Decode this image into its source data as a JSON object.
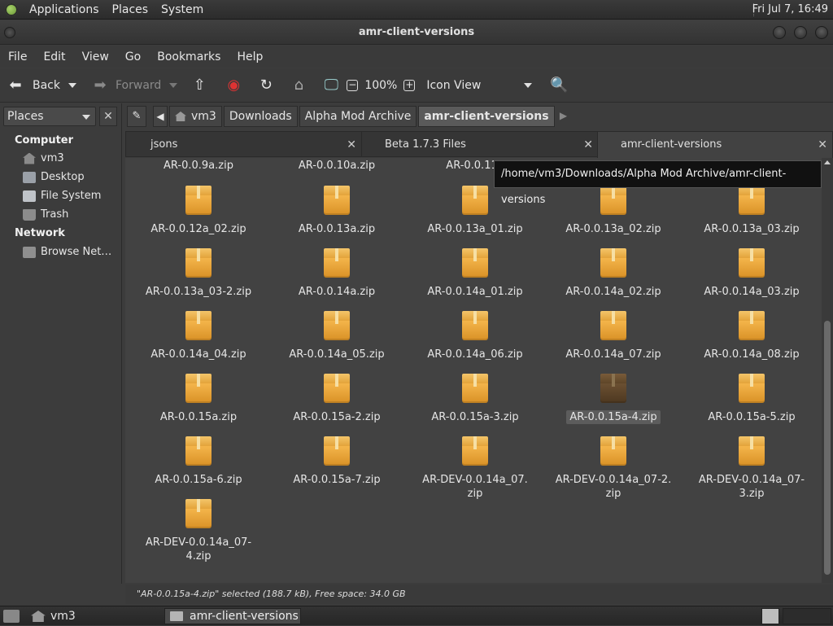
{
  "top_panel": {
    "menus": [
      "Applications",
      "Places",
      "System"
    ],
    "clock": "Fri Jul  7, 16:49"
  },
  "window": {
    "title": "amr-client-versions"
  },
  "menubar": [
    "File",
    "Edit",
    "View",
    "Go",
    "Bookmarks",
    "Help"
  ],
  "toolbar": {
    "back_label": "Back",
    "forward_label": "Forward",
    "zoom": "100%",
    "view_mode": "Icon View"
  },
  "sidebar": {
    "selector": "Places",
    "sections": [
      {
        "title": "Computer",
        "items": [
          "vm3",
          "Desktop",
          "File System",
          "Trash"
        ]
      },
      {
        "title": "Network",
        "items": [
          "Browse Net…"
        ]
      }
    ]
  },
  "location": {
    "crumbs": [
      "vm3",
      "Downloads",
      "Alpha Mod Archive",
      "amr-client-versions"
    ]
  },
  "tabs": [
    {
      "label": "jsons",
      "active": false
    },
    {
      "label": "Beta 1.7.3 Files",
      "active": false
    },
    {
      "label": "amr-client-versions",
      "active": true
    }
  ],
  "tooltip": "/home/vm3/Downloads/Alpha Mod Archive/amr-client-versions",
  "files_partial_row": [
    "AR-0.0.9a.zip",
    "AR-0.0.10a.zip",
    "AR-0.0.11a"
  ],
  "files": [
    [
      "AR-0.0.12a_02.zip",
      "AR-0.0.13a.zip",
      "AR-0.0.13a_01.zip",
      "AR-0.0.13a_02.zip",
      "AR-0.0.13a_03.zip"
    ],
    [
      "AR-0.0.13a_03-2.zip",
      "AR-0.0.14a.zip",
      "AR-0.0.14a_01.zip",
      "AR-0.0.14a_02.zip",
      "AR-0.0.14a_03.zip"
    ],
    [
      "AR-0.0.14a_04.zip",
      "AR-0.0.14a_05.zip",
      "AR-0.0.14a_06.zip",
      "AR-0.0.14a_07.zip",
      "AR-0.0.14a_08.zip"
    ],
    [
      "AR-0.0.15a.zip",
      "AR-0.0.15a-2.zip",
      "AR-0.0.15a-3.zip",
      "AR-0.0.15a-4.zip",
      "AR-0.0.15a-5.zip"
    ],
    [
      "AR-0.0.15a-6.zip",
      "AR-0.0.15a-7.zip",
      "AR-DEV-0.0.14a_07.\nzip",
      "AR-DEV-0.0.14a_07-2.\nzip",
      "AR-DEV-0.0.14a_07-\n3.zip"
    ],
    [
      "AR-DEV-0.0.14a_07-\n4.zip"
    ]
  ],
  "selected_file": "AR-0.0.15a-4.zip",
  "status": "\"AR-0.0.15a-4.zip\" selected (188.7 kB), Free space: 34.0 GB",
  "bottom_panel": {
    "launcher": "vm3",
    "task": "amr-client-versions"
  },
  "colors": {
    "archive_icon": "#f0b040",
    "selected_icon": "#5e4528",
    "background": "#424242"
  }
}
